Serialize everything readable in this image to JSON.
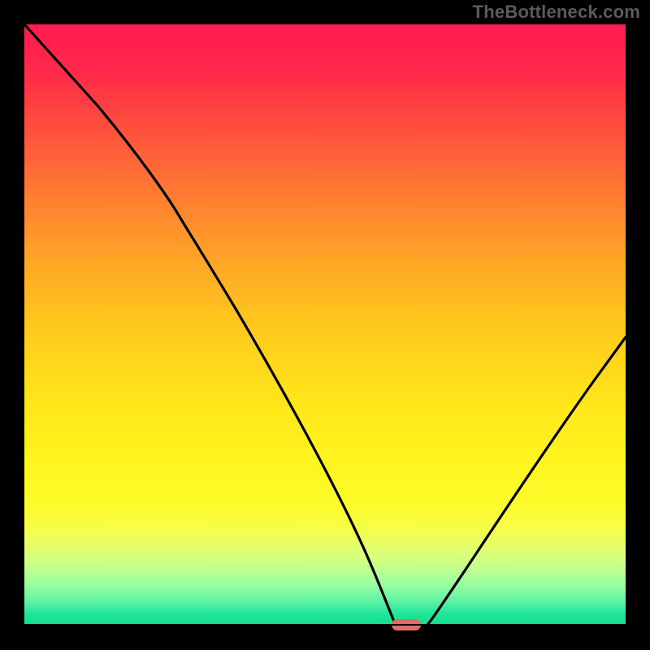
{
  "watermark": "TheBottleneck.com",
  "colors": {
    "background": "#000000",
    "gradient_top": "#ff1a4e",
    "gradient_bottom": "#12db8f",
    "curve_stroke": "#000000",
    "marker": "#e46a6a"
  },
  "chart_data": {
    "type": "line",
    "title": "",
    "xlabel": "",
    "ylabel": "",
    "xlim": [
      0,
      100
    ],
    "ylim": [
      0,
      100
    ],
    "grid": false,
    "legend": false,
    "annotations": [
      {
        "type": "marker",
        "x": 63,
        "y": 0,
        "shape": "pill",
        "color": "#e46a6a"
      }
    ],
    "series": [
      {
        "name": "bottleneck-curve",
        "x": [
          0,
          10,
          20,
          25,
          30,
          40,
          50,
          58,
          60,
          63,
          65,
          67,
          75,
          85,
          95,
          100
        ],
        "y": [
          100,
          90,
          80,
          73,
          70,
          55,
          38,
          18,
          10,
          0,
          0,
          3,
          15,
          30,
          45,
          50
        ]
      }
    ]
  }
}
